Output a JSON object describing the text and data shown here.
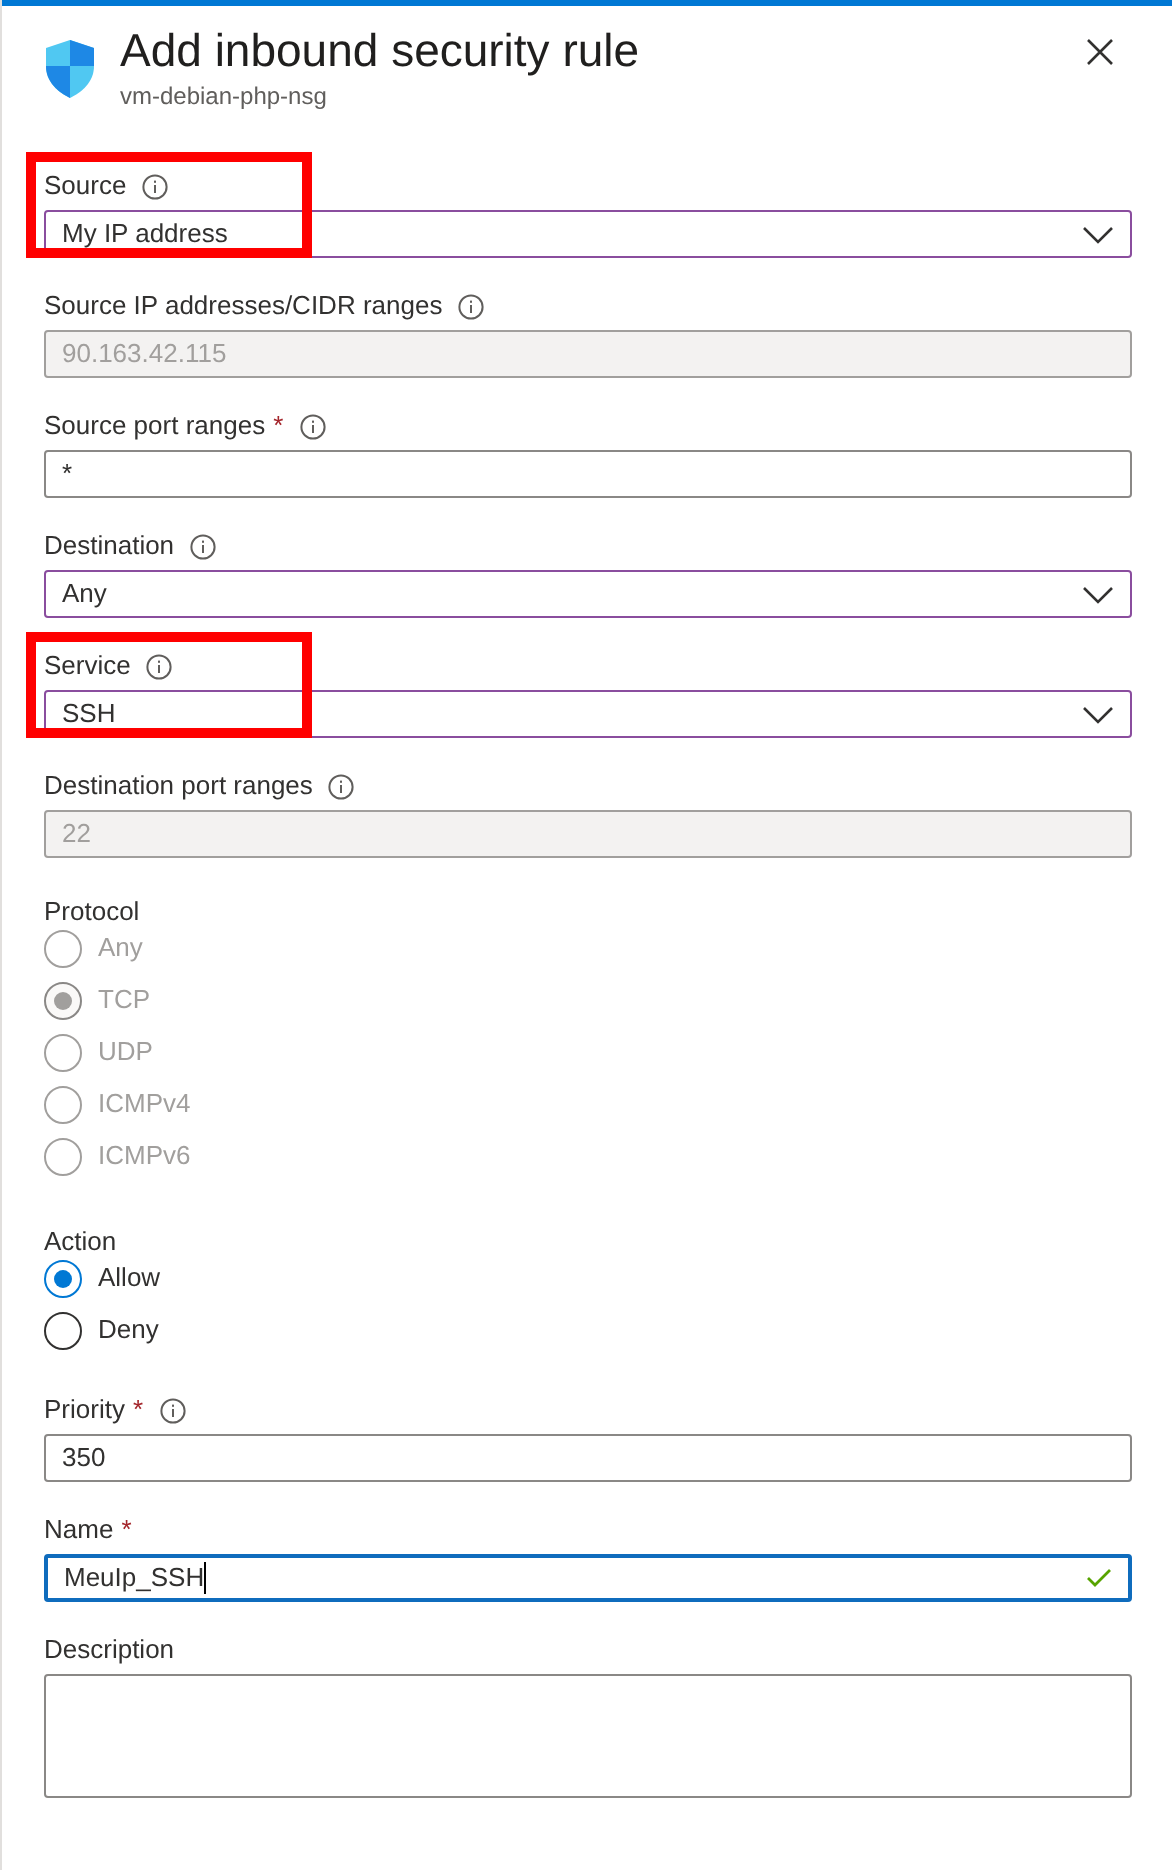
{
  "panel": {
    "title": "Add inbound security rule",
    "subtitle": "vm-debian-php-nsg"
  },
  "fields": [
    {
      "kind": "select",
      "label": "Source",
      "info": true,
      "value": "My IP address",
      "highlighted": true
    },
    {
      "kind": "text",
      "label": "Source IP addresses/CIDR ranges",
      "info": true,
      "value": "90.163.42.115",
      "disabled": true
    },
    {
      "kind": "text",
      "label": "Source port ranges",
      "info": true,
      "required": true,
      "value": "*"
    },
    {
      "kind": "select",
      "label": "Destination",
      "info": true,
      "value": "Any"
    },
    {
      "kind": "select",
      "label": "Service",
      "info": true,
      "value": "SSH",
      "highlighted": true
    },
    {
      "kind": "text",
      "label": "Destination port ranges",
      "info": true,
      "value": "22",
      "disabled": true
    },
    {
      "kind": "radio",
      "label": "Protocol",
      "disabled": true,
      "options": [
        {
          "label": "Any",
          "selected": false
        },
        {
          "label": "TCP",
          "selected": true
        },
        {
          "label": "UDP",
          "selected": false
        },
        {
          "label": "ICMPv4",
          "selected": false
        },
        {
          "label": "ICMPv6",
          "selected": false
        }
      ]
    },
    {
      "kind": "radio",
      "label": "Action",
      "options": [
        {
          "label": "Allow",
          "selected": true
        },
        {
          "label": "Deny",
          "selected": false
        }
      ]
    },
    {
      "kind": "text",
      "label": "Priority",
      "info": true,
      "required": true,
      "value": "350"
    },
    {
      "kind": "text",
      "label": "Name",
      "required": true,
      "value": "MeuIp_SSH",
      "focused": true,
      "valid": true
    },
    {
      "kind": "textarea",
      "label": "Description"
    }
  ]
}
